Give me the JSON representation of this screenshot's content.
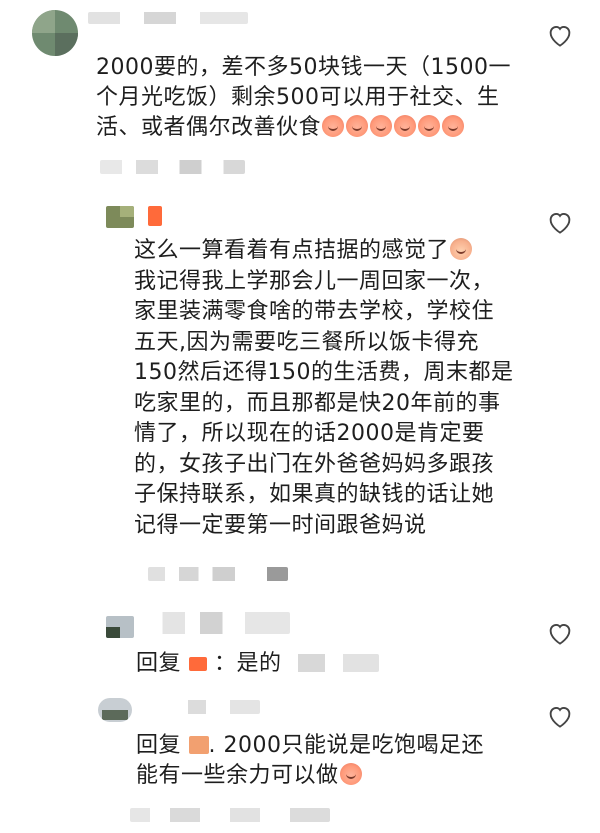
{
  "comments": [
    {
      "text": "2000要的，差不多50块钱一天（1500一个月光吃饭）剩余500可以用于社交、生活、或者偶尔改善伙食"
    },
    {
      "text": "这么一算看着有点拮据的感觉了我记得我上学那会儿一周回家一次，家里装满零食啥的带去学校，学校住五天,因为需要吃三餐所以饭卡得充150然后还得150的生活费，周末都是吃家里的，而且那都是快20年前的事情了，所以现在的话2000是肯定要的，女孩子出门在外爸爸妈妈多跟孩子保持联系，如果真的缺钱的话让她记得一定要第一时间跟爸妈说"
    },
    {
      "reply_prefix": "回复",
      "text": "：是的"
    },
    {
      "reply_prefix": "回复",
      "text": ". 2000只能说是吃饱喝足还能有一些余力可以做"
    }
  ],
  "lines": {
    "c1": [
      "2000要的，差不多50块钱一天（1500一",
      "个月光吃饭）剩余500可以用于社交、生",
      "活、或者偶尔改善伙食"
    ],
    "c2": [
      "这么一算看着有点拮据的感觉了",
      "我记得我上学那会儿一周回家一次，",
      "家里装满零食啥的带去学校，学校住",
      "五天,因为需要吃三餐所以饭卡得充",
      "150然后还得150的生活费，周末都是",
      "吃家里的，而且那都是快20年前的事",
      "情了，所以现在的话2000是肯定要",
      "的，女孩子出门在外爸爸妈妈多跟孩",
      "子保持联系，如果真的缺钱的话让她",
      "记得一定要第一时间跟爸妈说"
    ],
    "c3": "：是的",
    "c4a": ". 2000只能说是吃饱喝足还",
    "c4b": "能有一些余力可以做"
  },
  "icons": {
    "like": "heart-outline-icon",
    "emoji_peach": "peach-face-emoji",
    "emoji_sweat": "sweat-smile-emoji"
  },
  "colors": {
    "text": "#1e1e1e",
    "heart_stroke": "#444444",
    "tag_orange": "#ff6a3a"
  }
}
